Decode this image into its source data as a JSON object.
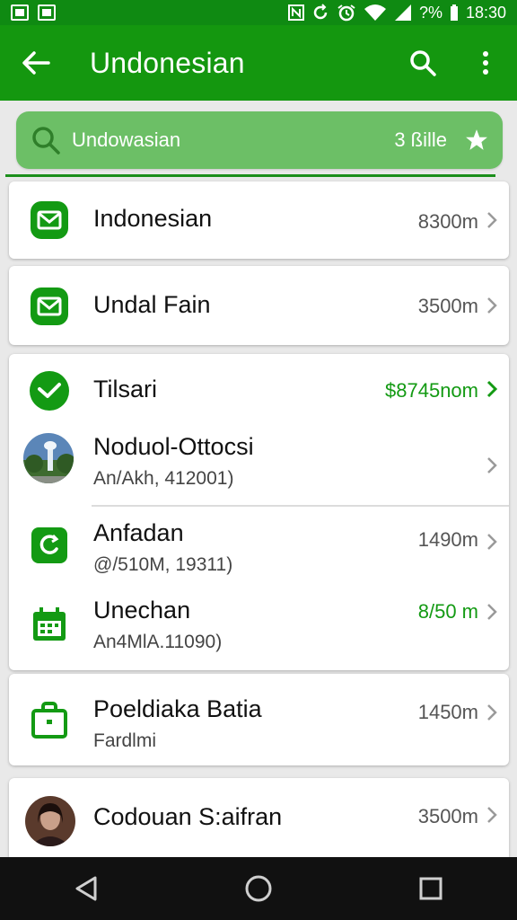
{
  "status_bar": {
    "time": "18:30",
    "battery": "?%"
  },
  "app_bar": {
    "title": "Undonesian"
  },
  "search": {
    "query": "Undowasian",
    "count": "3 ßille"
  },
  "cards": [
    {
      "rows": [
        {
          "title": "Indonesian",
          "value": "8300m",
          "icon": "mail-icon"
        }
      ]
    },
    {
      "rows": [
        {
          "title": "Undal Fain",
          "value": "3500m",
          "icon": "mail-icon"
        }
      ]
    },
    {
      "rows": [
        {
          "title": "Tilsari",
          "value": "$8745nom",
          "icon": "check-circle-icon"
        },
        {
          "title": "Noduol-Ottocsi",
          "subtitle": "An/Akh, 412001)",
          "value": "",
          "icon": "fountain-photo"
        },
        {
          "title": "Anfadan",
          "subtitle": "@/510M, 19311)",
          "value": "1490m",
          "icon": "refresh-icon"
        },
        {
          "title": "Unechan",
          "subtitle": "An4MlA.11090)",
          "value": "8/50 m",
          "icon": "calendar-icon"
        }
      ]
    },
    {
      "rows": [
        {
          "title": "Poeldiaka Batia",
          "subtitle": "Fardlmi",
          "value": "1450m",
          "icon": "bag-icon"
        }
      ]
    },
    {
      "rows": [
        {
          "title": "Codouan S:aifran",
          "value": "3500m",
          "icon": "person-avatar"
        }
      ]
    }
  ],
  "colors": {
    "appbar": "#14970f",
    "statusbar": "#0f8a12",
    "accent": "#139a13",
    "search": "#6cbf66"
  }
}
